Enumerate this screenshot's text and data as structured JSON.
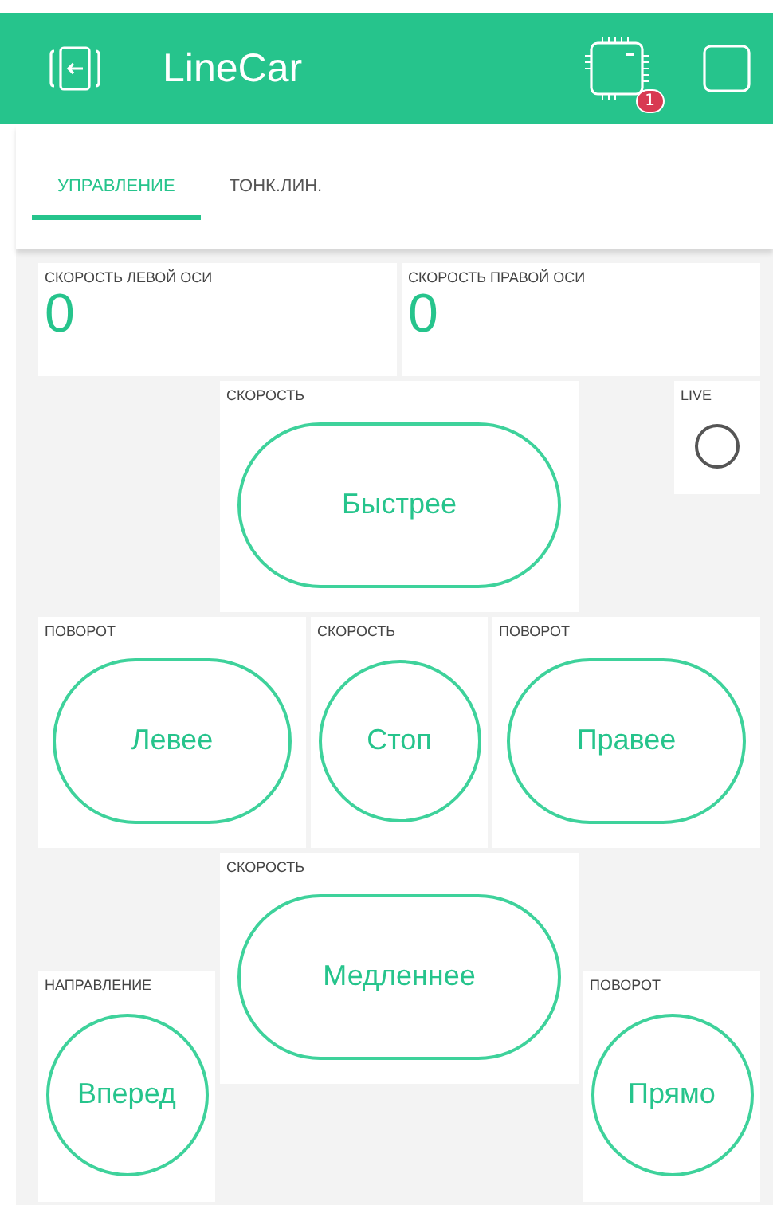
{
  "header": {
    "title": "LineCar",
    "badge": "1"
  },
  "tabs": [
    {
      "label": "УПРАВЛЕНИЕ",
      "selected": true
    },
    {
      "label": "ТОНК.ЛИН.",
      "selected": false
    }
  ],
  "widgets": [
    {
      "kind": "value",
      "label": "СКОРОСТЬ ЛЕВОЙ ОСИ",
      "value": "0"
    },
    {
      "kind": "value",
      "label": "СКОРОСТЬ ПРАВОЙ ОСИ",
      "value": "0"
    },
    {
      "kind": "button",
      "label": "СКОРОСТЬ",
      "text": "Быстрее"
    },
    {
      "kind": "led",
      "label": "LIVE",
      "on": false
    },
    {
      "kind": "button",
      "label": "ПОВОРОТ",
      "text": "Левее"
    },
    {
      "kind": "button",
      "label": "СКОРОСТЬ",
      "text": "Стоп"
    },
    {
      "kind": "button",
      "label": "ПОВОРОТ",
      "text": "Правее"
    },
    {
      "kind": "button",
      "label": "СКОРОСТЬ",
      "text": "Медленнее"
    },
    {
      "kind": "button",
      "label": "НАПРАВЛЕНИЕ",
      "text": "Вперед"
    },
    {
      "kind": "button",
      "label": "ПОВОРОТ",
      "text": "Прямо"
    }
  ]
}
